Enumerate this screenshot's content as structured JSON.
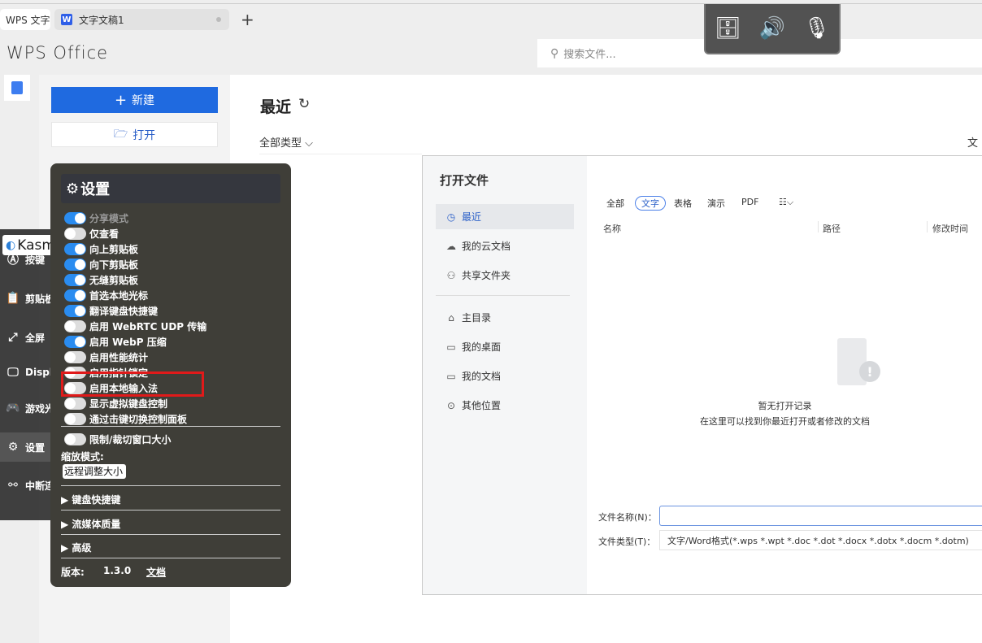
{
  "tabs": {
    "home": "WPS 文字",
    "doc": "文字文稿1",
    "doc_icon": "W",
    "add": "+"
  },
  "app": {
    "logo": "WPS Office",
    "search_placeholder": "搜索文件..."
  },
  "left": {
    "new": "新建",
    "open": "打开"
  },
  "main": {
    "title": "最近",
    "filter": "全部类型 ⌵",
    "col_file": "文"
  },
  "dialog": {
    "title": "打开文件",
    "nav": [
      {
        "label": "最近",
        "icon": "◷",
        "selected": true
      },
      {
        "label": "我的云文档",
        "icon": "☁"
      },
      {
        "label": "共享文件夹",
        "icon": "⚇"
      },
      {
        "label": "主目录",
        "icon": "⌂"
      },
      {
        "label": "我的桌面",
        "icon": "▭"
      },
      {
        "label": "我的文档",
        "icon": "▭"
      },
      {
        "label": "其他位置",
        "icon": "⊙"
      }
    ],
    "filters": [
      {
        "label": "全部"
      },
      {
        "label": "文字",
        "selected": true
      },
      {
        "label": "表格"
      },
      {
        "label": "演示"
      },
      {
        "label": "PDF"
      },
      {
        "label": "☷⌵"
      }
    ],
    "columns": [
      "名称",
      "路径",
      "修改时间"
    ],
    "empty_title": "暂无打开记录",
    "empty_desc": "在这里可以找到你最近打开或者修改的文档",
    "filename_label": "文件名称(N)：",
    "filename_value": "",
    "filetype_label": "文件类型(T)：",
    "filetype_value": "文字/Word格式(*.wps *.wpt *.doc *.dot *.docx *.dotx *.docm *.dotm)"
  },
  "kasm": {
    "logo": "KasmVNC",
    "items": [
      {
        "label": "按键",
        "icon": "Ⓐ"
      },
      {
        "label": "剪贴板",
        "icon": "📋"
      },
      {
        "label": "全屏",
        "icon": "⤢"
      },
      {
        "label": "Displays",
        "icon": "🖵"
      },
      {
        "label": "游戏光标模式",
        "icon": "🎮"
      },
      {
        "label": "设置",
        "icon": "⚙",
        "selected": true
      },
      {
        "label": "中断连接",
        "icon": "⚯"
      }
    ]
  },
  "settings": {
    "title": "设置",
    "toggles": [
      {
        "label": "分享模式",
        "on": true,
        "disabled": true
      },
      {
        "label": "仅查看",
        "on": false
      },
      {
        "label": "向上剪贴板",
        "on": true
      },
      {
        "label": "向下剪贴板",
        "on": true
      },
      {
        "label": "无缝剪贴板",
        "on": true
      },
      {
        "label": "首选本地光标",
        "on": true
      },
      {
        "label": "翻译键盘快捷键",
        "on": true
      },
      {
        "label": "启用 WebRTC UDP 传输",
        "on": false
      },
      {
        "label": "启用 WebP 压缩",
        "on": true
      },
      {
        "label": "启用性能统计",
        "on": false
      },
      {
        "label": "启用指针锁定",
        "on": false
      },
      {
        "label": "启用本地输入法",
        "on": false
      },
      {
        "label": "显示虚拟键盘控制",
        "on": false
      },
      {
        "label": "通过击键切换控制面板",
        "on": false
      }
    ],
    "clip_toggle": {
      "label": "限制/裁切窗口大小",
      "on": false
    },
    "zoom_label": "缩放模式:",
    "zoom_value": "远程调整大小",
    "sections": [
      "▶ 键盘快捷键",
      "▶ 流媒体质量",
      "▶ 高级"
    ],
    "version_label": "版本:",
    "version": "1.3.0",
    "docs": "文档"
  },
  "colors": {
    "accent": "#1f6ae0",
    "toggle_on": "#2a8cf0",
    "highlight": "#e01a1a"
  }
}
